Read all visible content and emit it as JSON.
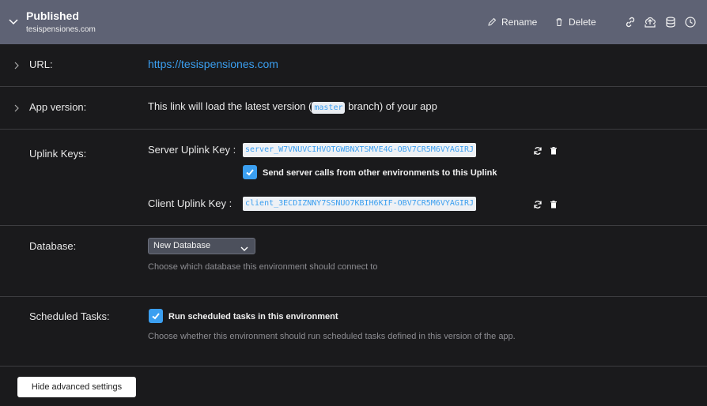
{
  "header": {
    "title": "Published",
    "subtitle": "tesispensiones.com",
    "rename_label": "Rename",
    "delete_label": "Delete",
    "icons": [
      "link-icon",
      "cloud-upload-icon",
      "database-icon",
      "clock-icon"
    ]
  },
  "url_row": {
    "label": "URL:",
    "value": "https://tesispensiones.com"
  },
  "version_row": {
    "label": "App version:",
    "text_before": "This link will load the latest version (",
    "branch": "master",
    "text_after": " branch) of your app"
  },
  "uplink_row": {
    "label": "Uplink Keys:",
    "server_label": "Server Uplink Key :",
    "server_key": "server_W7VNUVCIHVOTGWBNXTSMVE4G-OBV7CR5M6VYAGIRJ",
    "send_calls_checked": true,
    "send_calls_label": "Send server calls from other environments to this Uplink",
    "client_label": "Client Uplink Key :",
    "client_key": "client_3ECDIZNNY7SSNUO7KBIH6KIF-OBV7CR5M6VYAGIRJ"
  },
  "database_row": {
    "label": "Database:",
    "selected": "New Database",
    "hint": "Choose which database this environment should connect to"
  },
  "tasks_row": {
    "label": "Scheduled Tasks:",
    "checked": true,
    "checkbox_label": "Run scheduled tasks in this environment",
    "hint": "Choose whether this environment should run scheduled tasks defined in this version of the app."
  },
  "footer": {
    "hide_button_label": "Hide advanced settings"
  },
  "colors": {
    "header_bg": "#5e6274",
    "page_bg": "#1a1a1c",
    "accent": "#3b9ff0",
    "divider": "#3d3d40"
  }
}
